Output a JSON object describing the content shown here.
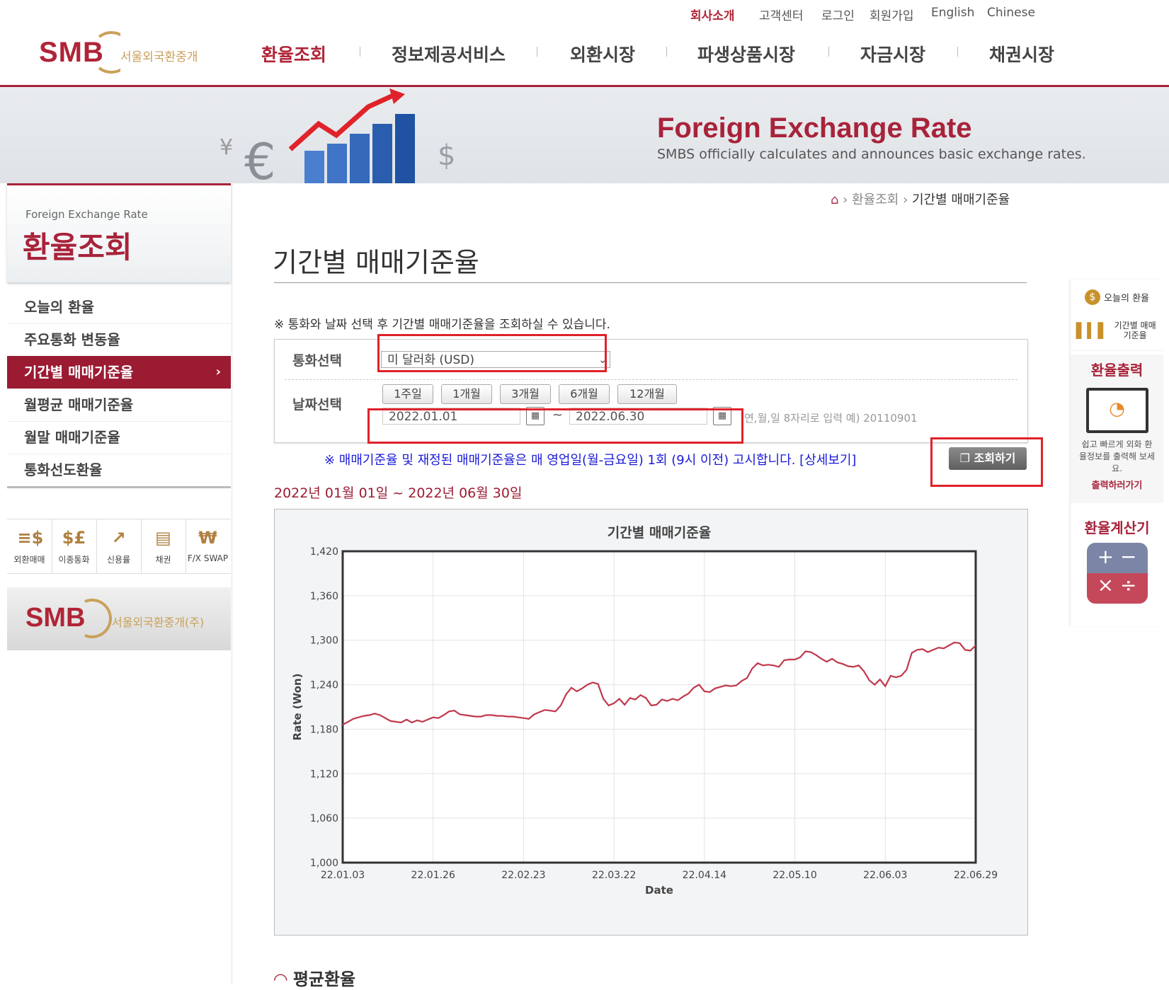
{
  "top_links": [
    "회사소개",
    "고객센터",
    "로그인",
    "회원가입",
    "English",
    "Chinese"
  ],
  "logo": {
    "text": "SMB",
    "sub": "서울외국환중개"
  },
  "gnb": [
    "환율조회",
    "정보제공서비스",
    "외환시장",
    "파생상품시장",
    "자금시장",
    "채권시장"
  ],
  "banner": {
    "title": "Foreign Exchange Rate",
    "subtitle": "SMBS officially calculates and announces basic exchange rates."
  },
  "sidebar": {
    "en": "Foreign Exchange Rate",
    "title": "환율조회",
    "items": [
      "오늘의 환율",
      "주요통화 변동율",
      "기간별 매매기준율",
      "월평균 매매기준율",
      "월말 매매기준율",
      "통화선도환율"
    ],
    "active_index": 2,
    "quick": [
      "외환매매",
      "이종통화",
      "신용률",
      "채권",
      "F/X SWAP"
    ],
    "footer_logo": {
      "text": "SMB",
      "sub": "서울외국환중개(주)"
    }
  },
  "breadcrumb": [
    "환율조회",
    "기간별 매매기준율"
  ],
  "page_title": "기간별 매매기준율",
  "note": "※ 통화와 날짜 선택 후 기간별 매매기준율을 조회하실 수 있습니다.",
  "form": {
    "currency_label": "통화선택",
    "currency_value": "미 달러화 (USD)",
    "date_label": "날짜선택",
    "periods": [
      "1주일",
      "1개월",
      "3개월",
      "6개월",
      "12개월"
    ],
    "start_date": "2022.01.01",
    "end_date": "2022.06.30",
    "tilde": "~",
    "hint": "연,월,일 8자리로 입력 예) 20110901"
  },
  "info_text": "※ 매매기준율 및 재정된 매매기준율은 매 영업일(월-금요일) 1회 (9시 이전) 고시합니다.",
  "info_more": "[상세보기]",
  "search_button": "조회하기",
  "range_text": "2022년 01월 01일 ~ 2022년 06월 30일",
  "avg_title": "평균환율",
  "right_quick": {
    "today": "오늘의 환율",
    "period": "기간별 매매기준율",
    "print_title": "환율출력",
    "print_desc": "쉽고 빠르게 외화 환율정보를 출력해 보세요.",
    "print_link": "출력하러가기",
    "calc_title": "환율계산기"
  },
  "colors": {
    "brand": "#a8233a",
    "line": "#c0384b",
    "info_blue": "#1a1ad8",
    "highlight": "#e0222a"
  },
  "chart_data": {
    "type": "line",
    "title": "기간별 매매기준율",
    "xlabel": "Date",
    "ylabel": "Rate (Won)",
    "ylim": [
      1000,
      1420
    ],
    "yticks": [
      1000,
      1060,
      1120,
      1180,
      1240,
      1300,
      1360,
      1420
    ],
    "xticks": [
      "22.01.03",
      "22.01.26",
      "22.02.23",
      "22.03.22",
      "22.04.14",
      "22.05.10",
      "22.06.03",
      "22.06.29"
    ],
    "grid": true,
    "series": [
      {
        "values": [
          1186,
          1190,
          1194,
          1196,
          1198,
          1199,
          1201,
          1199,
          1195,
          1191,
          1190,
          1189,
          1193,
          1189,
          1192,
          1190,
          1193,
          1196,
          1195,
          1199,
          1204,
          1205,
          1200,
          1199,
          1198,
          1197,
          1197,
          1199,
          1199,
          1198,
          1198,
          1197,
          1197,
          1196,
          1195,
          1194,
          1200,
          1203,
          1206,
          1205,
          1204,
          1212,
          1227,
          1236,
          1231,
          1235,
          1240,
          1243,
          1241,
          1221,
          1212,
          1215,
          1221,
          1213,
          1222,
          1220,
          1226,
          1222,
          1212,
          1213,
          1220,
          1218,
          1221,
          1219,
          1224,
          1228,
          1236,
          1240,
          1231,
          1230,
          1235,
          1237,
          1239,
          1238,
          1239,
          1245,
          1249,
          1262,
          1269,
          1266,
          1267,
          1266,
          1264,
          1273,
          1274,
          1274,
          1277,
          1285,
          1284,
          1280,
          1275,
          1271,
          1275,
          1270,
          1268,
          1265,
          1264,
          1266,
          1258,
          1246,
          1240,
          1247,
          1238,
          1252,
          1250,
          1252,
          1260,
          1283,
          1287,
          1288,
          1284,
          1287,
          1290,
          1289,
          1293,
          1297,
          1296,
          1287,
          1286,
          1293
        ]
      }
    ]
  }
}
